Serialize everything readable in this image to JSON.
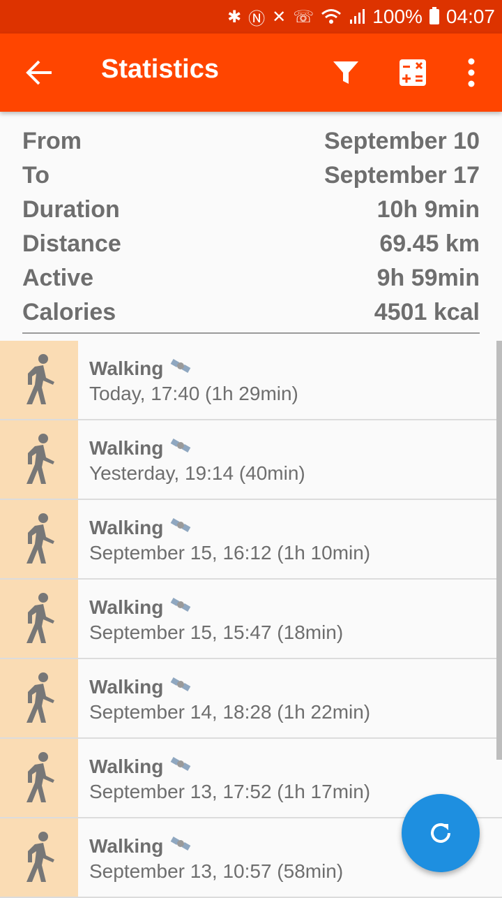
{
  "status_bar": {
    "battery": "100%",
    "time": "04:07",
    "icons": [
      "bluetooth-icon",
      "nfc-icon",
      "mute-icon",
      "wifi-calling-icon",
      "wifi-icon",
      "signal-icon",
      "battery-charging-icon"
    ]
  },
  "app_bar": {
    "title": "Statistics",
    "background": "#ff4500"
  },
  "summary": [
    {
      "label": "From",
      "value": "September 10"
    },
    {
      "label": "To",
      "value": "September 17"
    },
    {
      "label": "Duration",
      "value": "10h 9min"
    },
    {
      "label": "Distance",
      "value": "69.45 km"
    },
    {
      "label": "Active",
      "value": "9h 59min"
    },
    {
      "label": "Calories",
      "value": "4501 kcal"
    }
  ],
  "activities": [
    {
      "type": "Walking",
      "when": "Today, 17:40 (1h 29min)"
    },
    {
      "type": "Walking",
      "when": "Yesterday, 19:14 (40min)"
    },
    {
      "type": "Walking",
      "when": "September 15, 16:12 (1h 10min)"
    },
    {
      "type": "Walking",
      "when": "September 15, 15:47 (18min)"
    },
    {
      "type": "Walking",
      "when": "September 14, 18:28 (1h 22min)"
    },
    {
      "type": "Walking",
      "when": "September 13, 17:52 (1h 17min)"
    },
    {
      "type": "Walking",
      "when": "September 13, 10:57 (58min)"
    }
  ],
  "fab": {
    "icon": "refresh-icon",
    "color": "#1e8fe0"
  }
}
